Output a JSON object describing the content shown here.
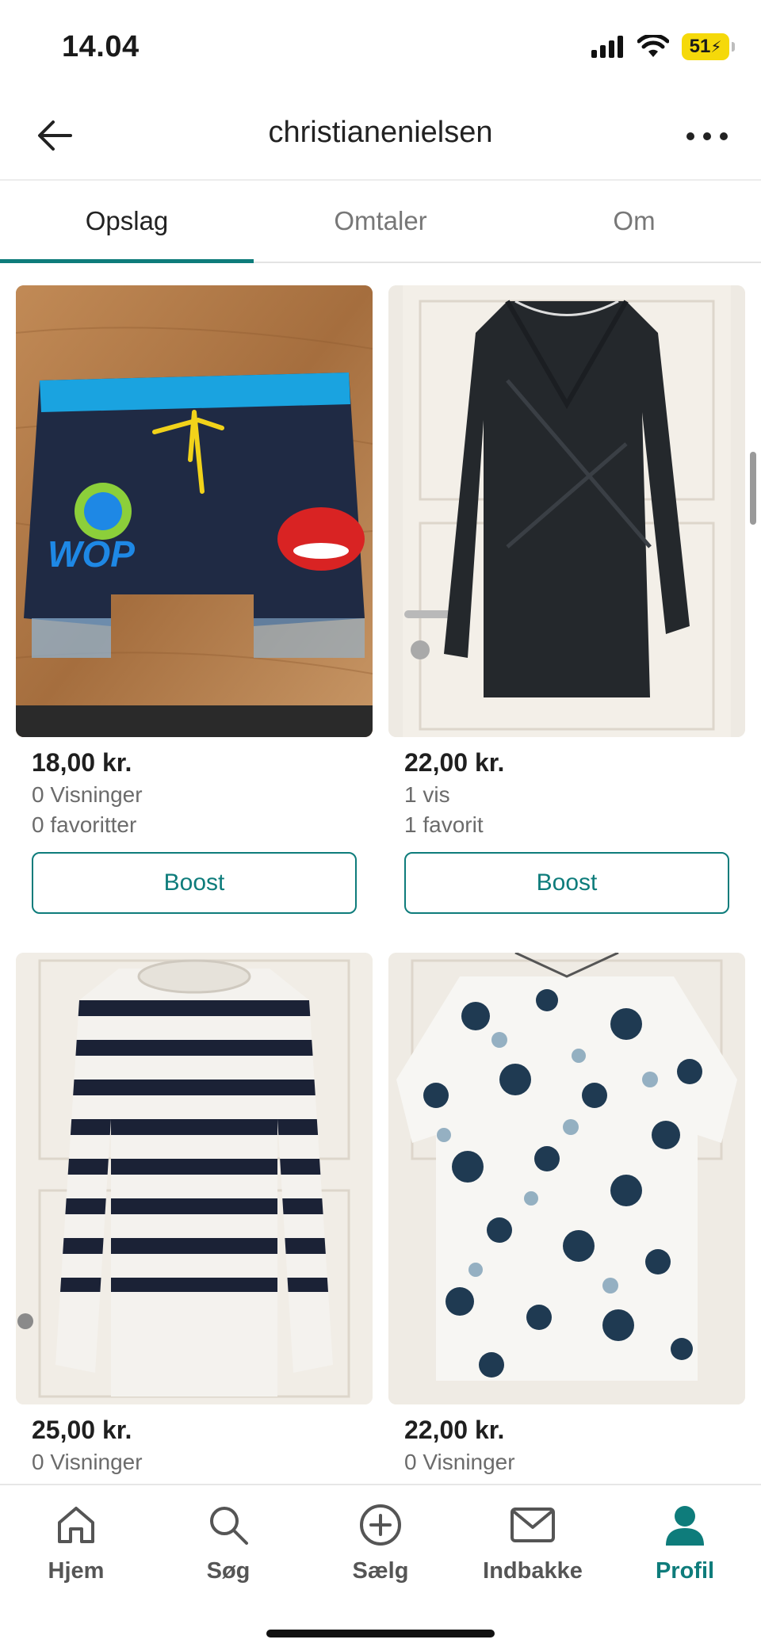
{
  "status_bar": {
    "time": "14.04",
    "battery": "51"
  },
  "header": {
    "title": "christianenielsen"
  },
  "tabs": [
    {
      "label": "Opslag",
      "active": true
    },
    {
      "label": "Omtaler",
      "active": false
    },
    {
      "label": "Om",
      "active": false
    }
  ],
  "listings": [
    {
      "price": "18,00 kr.",
      "views": "0 Visninger",
      "favorites": "0 favoritter",
      "boost_label": "Boost",
      "image": "swim-shorts"
    },
    {
      "price": "22,00 kr.",
      "views": "1 vis",
      "favorites": "1 favorit",
      "boost_label": "Boost",
      "image": "black-wrap-dress"
    },
    {
      "price": "25,00 kr.",
      "views": "0 Visninger",
      "favorites": "",
      "boost_label": "",
      "image": "striped-sweater"
    },
    {
      "price": "22,00 kr.",
      "views": "0 Visninger",
      "favorites": "",
      "boost_label": "",
      "image": "floral-top"
    }
  ],
  "bottom_nav": [
    {
      "label": "Hjem",
      "icon": "home-icon",
      "active": false
    },
    {
      "label": "Søg",
      "icon": "search-icon",
      "active": false
    },
    {
      "label": "Sælg",
      "icon": "plus-circle-icon",
      "active": false
    },
    {
      "label": "Indbakke",
      "icon": "mail-icon",
      "active": false
    },
    {
      "label": "Profil",
      "icon": "profile-icon",
      "active": true
    }
  ],
  "colors": {
    "accent": "#0e7c7b",
    "battery": "#f5d90a"
  }
}
